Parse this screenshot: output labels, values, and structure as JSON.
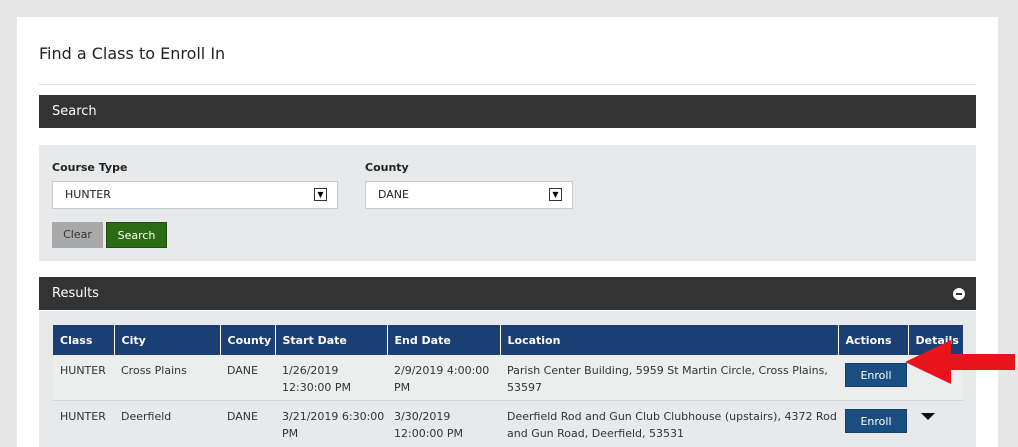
{
  "page": {
    "title": "Find a Class to Enroll In"
  },
  "search": {
    "heading": "Search",
    "course_type": {
      "label": "Course Type",
      "value": "HUNTER"
    },
    "county": {
      "label": "County",
      "value": "DANE"
    },
    "clear_label": "Clear",
    "search_label": "Search"
  },
  "results": {
    "heading": "Results",
    "columns": [
      "Class",
      "City",
      "County",
      "Start Date",
      "End Date",
      "Location",
      "Actions",
      "Details"
    ],
    "rows": [
      {
        "class": "HUNTER",
        "city": "Cross Plains",
        "county": "DANE",
        "start_date": "1/26/2019 12:30:00 PM",
        "end_date": "2/9/2019 4:00:00 PM",
        "location": "Parish Center Building, 5959 St Martin Circle, Cross Plains, 53597",
        "action_label": "Enroll"
      },
      {
        "class": "HUNTER",
        "city": "Deerfield",
        "county": "DANE",
        "start_date": "3/21/2019 6:30:00 PM",
        "end_date": "3/30/2019 12:00:00 PM",
        "location": "Deerfield Rod and Gun Club Clubhouse (upstairs), 4372 Rod and Gun Road, Deerfield, 53531",
        "action_label": "Enroll"
      }
    ]
  },
  "colors": {
    "panel_header": "#333333",
    "table_header": "#1b3f73",
    "search_button": "#2b6b14",
    "enroll_button": "#1b4e80",
    "pointer_arrow": "#e8141b"
  }
}
